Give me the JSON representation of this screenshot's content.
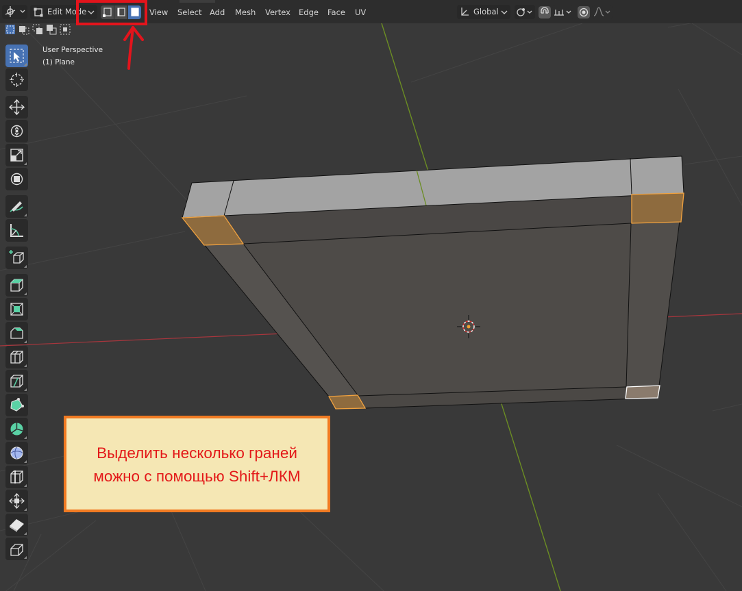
{
  "app": {
    "name": "Blender 3D Viewport"
  },
  "header": {
    "mode_label": "Edit Mode",
    "menu": [
      "View",
      "Select",
      "Add",
      "Mesh",
      "Vertex",
      "Edge",
      "Face",
      "UV"
    ],
    "transform_orientation": "Global",
    "select_modes": [
      "vertex",
      "edge",
      "face"
    ],
    "active_select_mode": "face"
  },
  "overlay": {
    "view_name": "User Perspective",
    "object_name": "(1) Plane"
  },
  "toolbar": {
    "tools": [
      {
        "name": "select-box-tool",
        "active": true
      },
      {
        "name": "cursor-tool"
      },
      {
        "name": "move-tool"
      },
      {
        "name": "rotate-tool"
      },
      {
        "name": "scale-tool"
      },
      {
        "name": "transform-tool"
      },
      {
        "name": "annotate-tool"
      },
      {
        "name": "measure-tool"
      },
      {
        "name": "add-cube-tool"
      },
      {
        "name": "extrude-region-tool"
      },
      {
        "name": "inset-faces-tool"
      },
      {
        "name": "bevel-tool"
      },
      {
        "name": "loop-cut-tool"
      },
      {
        "name": "knife-tool"
      },
      {
        "name": "poly-build-tool"
      },
      {
        "name": "spin-tool"
      },
      {
        "name": "smooth-tool"
      },
      {
        "name": "edge-slide-tool"
      },
      {
        "name": "shrink-fatten-tool"
      },
      {
        "name": "shear-tool"
      },
      {
        "name": "rip-region-tool"
      }
    ]
  },
  "callout": {
    "line1": "Выделить несколько граней",
    "line2": "можно с помощью Shift+ЛКМ"
  },
  "colors": {
    "viewport_bg": "#393939",
    "header_bg": "#2d2d2d",
    "active_blue": "#4772b3",
    "selected_face": "#f1a23f",
    "annotation_red": "#e3141c",
    "callout_bg": "#f5e7b4",
    "callout_border": "#f07a22",
    "callout_text": "#e31919",
    "axis_x": "#a8363d",
    "axis_y": "#6b8d23"
  }
}
